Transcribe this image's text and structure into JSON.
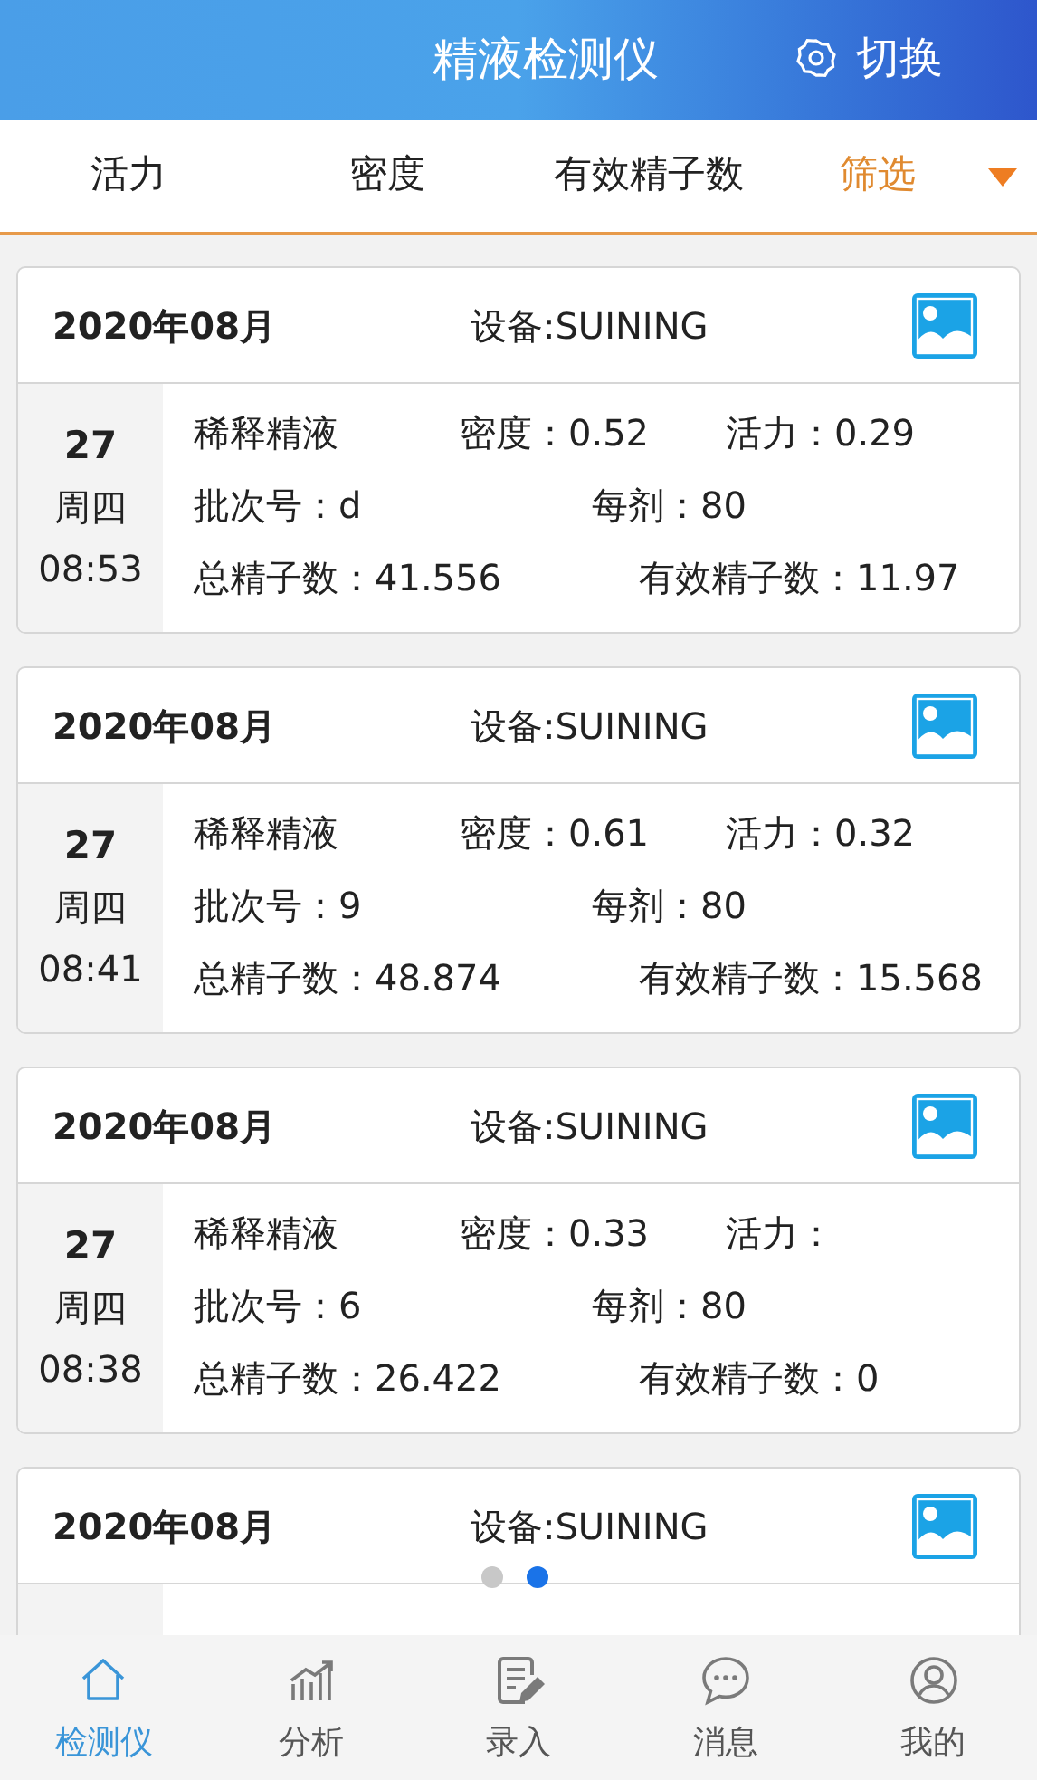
{
  "header": {
    "title": "精液检测仪",
    "switch_label": "切换"
  },
  "filter_bar": {
    "tabs": [
      {
        "label": "活力",
        "selected": false
      },
      {
        "label": "密度",
        "selected": false
      },
      {
        "label": "有效精子数",
        "selected": false
      },
      {
        "label": "筛选",
        "selected": true
      }
    ]
  },
  "records": [
    {
      "month": "2020年08月",
      "device": "设备:SUINING",
      "day": "27",
      "weekday": "周四",
      "time": "08:53",
      "rows": [
        [
          "稀释精液",
          "密度：0.52",
          "活力：0.29"
        ],
        [
          "批次号：d",
          "每剂：80"
        ],
        [
          "总精子数：41.556",
          "有效精子数：11.97"
        ]
      ]
    },
    {
      "month": "2020年08月",
      "device": "设备:SUINING",
      "day": "27",
      "weekday": "周四",
      "time": "08:41",
      "rows": [
        [
          "稀释精液",
          "密度：0.61",
          "活力：0.32"
        ],
        [
          "批次号：9",
          "每剂：80"
        ],
        [
          "总精子数：48.874",
          "有效精子数：15.568"
        ]
      ]
    },
    {
      "month": "2020年08月",
      "device": "设备:SUINING",
      "day": "27",
      "weekday": "周四",
      "time": "08:38",
      "rows": [
        [
          "稀释精液",
          "密度：0.33",
          "活力："
        ],
        [
          "批次号：6",
          "每剂：80"
        ],
        [
          "总精子数：26.422",
          "有效精子数：0"
        ]
      ]
    },
    {
      "month": "2020年08月",
      "device": "设备:SUINING"
    }
  ],
  "pager_dots": [
    {
      "selected": false
    },
    {
      "selected": true
    }
  ],
  "bottom_nav": [
    {
      "label": "检测仪",
      "kind": "home",
      "selected": true
    },
    {
      "label": "分析",
      "kind": "chart",
      "selected": false
    },
    {
      "label": "录入",
      "kind": "edit",
      "selected": false
    },
    {
      "label": "消息",
      "kind": "chat",
      "selected": false
    },
    {
      "label": "我的",
      "kind": "user",
      "selected": false
    }
  ]
}
